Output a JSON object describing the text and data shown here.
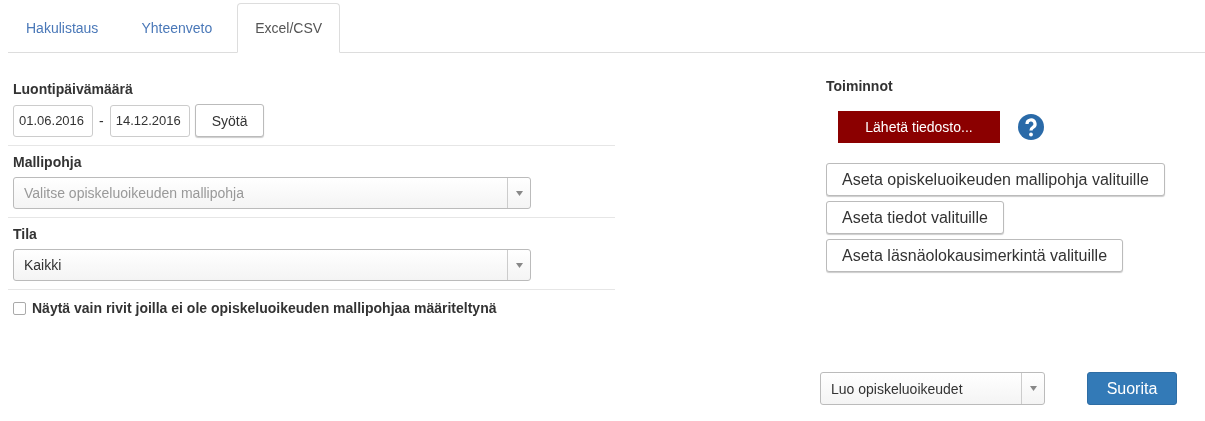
{
  "tabs": [
    {
      "label": "Hakulistaus",
      "selected": false
    },
    {
      "label": "Yhteenveto",
      "selected": false
    },
    {
      "label": "Excel/CSV",
      "selected": true
    }
  ],
  "filters": {
    "date": {
      "label": "Luontipäivämäärä",
      "from": "01.06.2016",
      "separator": "-",
      "to": "14.12.2016",
      "button": "Syötä"
    },
    "template": {
      "label": "Mallipohja",
      "placeholder": "Valitse opiskeluoikeuden mallipohja"
    },
    "state": {
      "label": "Tila",
      "value": "Kaikki"
    },
    "only_missing": {
      "label": "Näytä vain rivit joilla ei ole opiskeluoikeuden mallipohjaa määriteltynä",
      "checked": false
    }
  },
  "actions": {
    "title": "Toiminnot",
    "upload_button": "Lähetä tiedosto...",
    "buttons": [
      "Aseta opiskeluoikeuden mallipohja valituille",
      "Aseta tiedot valituille",
      "Aseta läsnäolokausimerkintä valituille"
    ]
  },
  "run": {
    "operation": "Luo opiskeluoikeudet",
    "button": "Suorita"
  }
}
